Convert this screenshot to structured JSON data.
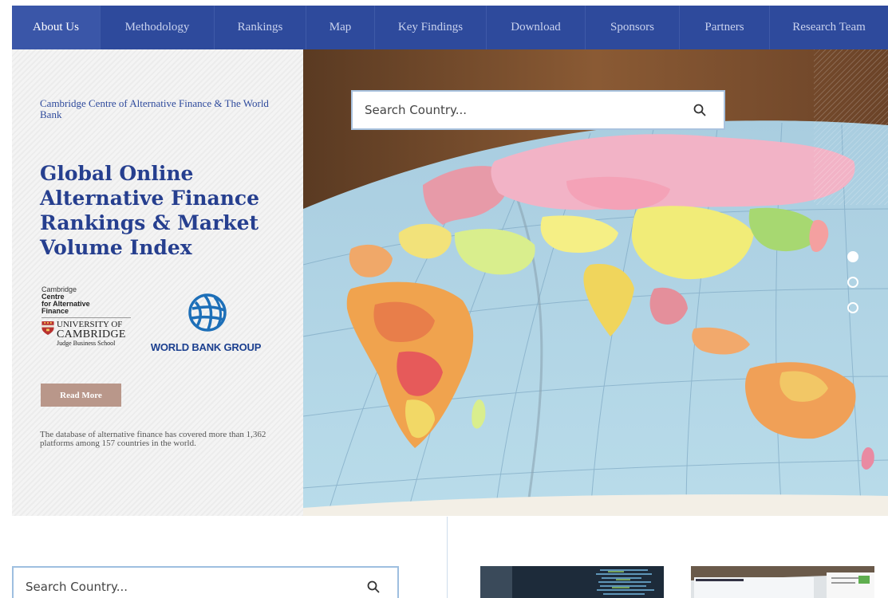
{
  "nav": {
    "items": [
      {
        "label": "About Us",
        "active": true
      },
      {
        "label": "Methodology"
      },
      {
        "label": "Rankings"
      },
      {
        "label": "Map"
      },
      {
        "label": "Key Findings"
      },
      {
        "label": "Download"
      },
      {
        "label": "Sponsors"
      },
      {
        "label": "Partners"
      },
      {
        "label": "Research Team"
      }
    ]
  },
  "hero": {
    "org_line": "Cambridge Centre of Alternative Finance & The World Bank",
    "title": "Global Online Alternative Finance Rankings & Market Volume Index",
    "ccaf_logo": {
      "line1": "Cambridge",
      "line2": "Centre",
      "line3": "for Alternative",
      "line4": "Finance",
      "uni1": "UNIVERSITY OF",
      "uni2": "CAMBRIDGE",
      "uni3": "Judge Business School"
    },
    "wb_logo": "WORLD BANK GROUP",
    "read_more": "Read More",
    "description": "The database of alternative finance has covered more than 1,362 platforms among 157 countries in the world.",
    "search_placeholder": "Search Country...",
    "carousel": {
      "slides": 3,
      "active_index": 0
    }
  },
  "bottom": {
    "search_placeholder": "Search Country..."
  },
  "colors": {
    "nav_bg": "#2e4a9c",
    "title": "#263f8f",
    "read_more_bg": "#b9978a"
  }
}
